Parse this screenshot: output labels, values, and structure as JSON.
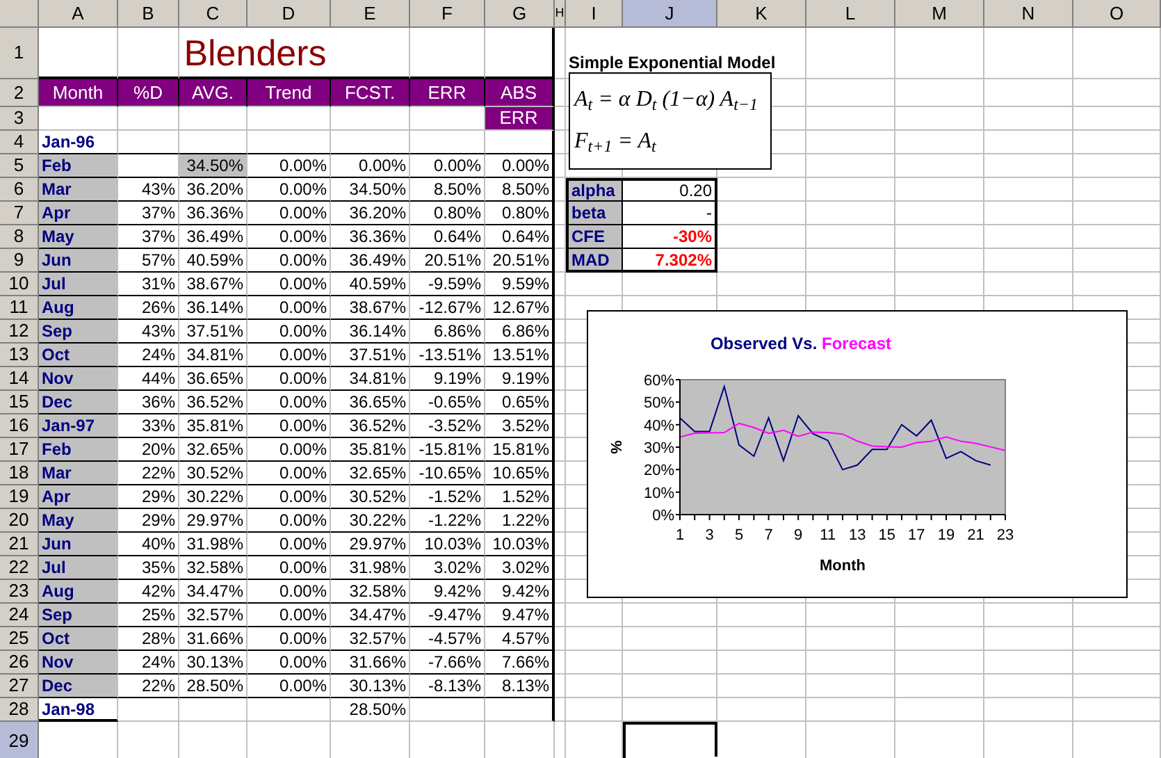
{
  "column_headers": [
    {
      "label": "A",
      "selected": false
    },
    {
      "label": "B",
      "selected": false
    },
    {
      "label": "C",
      "selected": false
    },
    {
      "label": "D",
      "selected": false
    },
    {
      "label": "E",
      "selected": false
    },
    {
      "label": "F",
      "selected": false
    },
    {
      "label": "G",
      "selected": false
    },
    {
      "label": "H",
      "selected": false
    },
    {
      "label": "I",
      "selected": false
    },
    {
      "label": "J",
      "selected": true
    },
    {
      "label": "K",
      "selected": false
    },
    {
      "label": "L",
      "selected": false
    },
    {
      "label": "M",
      "selected": false
    },
    {
      "label": "N",
      "selected": false
    },
    {
      "label": "O",
      "selected": false
    }
  ],
  "row_headers": [
    {
      "label": "1",
      "selected": false
    },
    {
      "label": "2",
      "selected": false
    },
    {
      "label": "3",
      "selected": false
    },
    {
      "label": "4",
      "selected": false
    },
    {
      "label": "5",
      "selected": false
    },
    {
      "label": "6",
      "selected": false
    },
    {
      "label": "7",
      "selected": false
    },
    {
      "label": "8",
      "selected": false
    },
    {
      "label": "9",
      "selected": false
    },
    {
      "label": "10",
      "selected": false
    },
    {
      "label": "11",
      "selected": false
    },
    {
      "label": "12",
      "selected": false
    },
    {
      "label": "13",
      "selected": false
    },
    {
      "label": "14",
      "selected": false
    },
    {
      "label": "15",
      "selected": false
    },
    {
      "label": "16",
      "selected": false
    },
    {
      "label": "17",
      "selected": false
    },
    {
      "label": "18",
      "selected": false
    },
    {
      "label": "19",
      "selected": false
    },
    {
      "label": "20",
      "selected": false
    },
    {
      "label": "21",
      "selected": false
    },
    {
      "label": "22",
      "selected": false
    },
    {
      "label": "23",
      "selected": false
    },
    {
      "label": "24",
      "selected": false
    },
    {
      "label": "25",
      "selected": false
    },
    {
      "label": "26",
      "selected": false
    },
    {
      "label": "27",
      "selected": false
    },
    {
      "label": "28",
      "selected": false
    },
    {
      "label": "29",
      "selected": true
    }
  ],
  "sheet_title": "Blenders",
  "table": {
    "columns": [
      "Month",
      "%D",
      "AVG.",
      "Trend",
      "FCST.",
      "ERR",
      "ABS"
    ],
    "last_column_line2": "ERR",
    "rows": [
      {
        "month": "Jan-96",
        "month_shaded": false,
        "avg_shaded": false
      },
      {
        "month": "Feb",
        "month_shaded": true,
        "avg_shaded": true,
        "avg": "34.50%",
        "trend": "0.00%",
        "fcst": "0.00%",
        "err": "0.00%",
        "abs_err": "0.00%"
      },
      {
        "month": "Mar",
        "month_shaded": true,
        "avg_shaded": false,
        "d": "43%",
        "avg": "36.20%",
        "trend": "0.00%",
        "fcst": "34.50%",
        "err": "8.50%",
        "abs_err": "8.50%"
      },
      {
        "month": "Apr",
        "month_shaded": true,
        "avg_shaded": false,
        "d": "37%",
        "avg": "36.36%",
        "trend": "0.00%",
        "fcst": "36.20%",
        "err": "0.80%",
        "abs_err": "0.80%"
      },
      {
        "month": "May",
        "month_shaded": true,
        "avg_shaded": false,
        "d": "37%",
        "avg": "36.49%",
        "trend": "0.00%",
        "fcst": "36.36%",
        "err": "0.64%",
        "abs_err": "0.64%"
      },
      {
        "month": "Jun",
        "month_shaded": true,
        "avg_shaded": false,
        "d": "57%",
        "avg": "40.59%",
        "trend": "0.00%",
        "fcst": "36.49%",
        "err": "20.51%",
        "abs_err": "20.51%"
      },
      {
        "month": "Jul",
        "month_shaded": true,
        "avg_shaded": false,
        "d": "31%",
        "avg": "38.67%",
        "trend": "0.00%",
        "fcst": "40.59%",
        "err": "-9.59%",
        "abs_err": "9.59%"
      },
      {
        "month": "Aug",
        "month_shaded": true,
        "avg_shaded": false,
        "d": "26%",
        "avg": "36.14%",
        "trend": "0.00%",
        "fcst": "38.67%",
        "err": "-12.67%",
        "abs_err": "12.67%"
      },
      {
        "month": "Sep",
        "month_shaded": true,
        "avg_shaded": false,
        "d": "43%",
        "avg": "37.51%",
        "trend": "0.00%",
        "fcst": "36.14%",
        "err": "6.86%",
        "abs_err": "6.86%"
      },
      {
        "month": "Oct",
        "month_shaded": true,
        "avg_shaded": false,
        "d": "24%",
        "avg": "34.81%",
        "trend": "0.00%",
        "fcst": "37.51%",
        "err": "-13.51%",
        "abs_err": "13.51%"
      },
      {
        "month": "Nov",
        "month_shaded": true,
        "avg_shaded": false,
        "d": "44%",
        "avg": "36.65%",
        "trend": "0.00%",
        "fcst": "34.81%",
        "err": "9.19%",
        "abs_err": "9.19%"
      },
      {
        "month": "Dec",
        "month_shaded": true,
        "avg_shaded": false,
        "d": "36%",
        "avg": "36.52%",
        "trend": "0.00%",
        "fcst": "36.65%",
        "err": "-0.65%",
        "abs_err": "0.65%"
      },
      {
        "month": "Jan-97",
        "month_shaded": true,
        "avg_shaded": false,
        "d": "33%",
        "avg": "35.81%",
        "trend": "0.00%",
        "fcst": "36.52%",
        "err": "-3.52%",
        "abs_err": "3.52%"
      },
      {
        "month": "Feb",
        "month_shaded": true,
        "avg_shaded": false,
        "d": "20%",
        "avg": "32.65%",
        "trend": "0.00%",
        "fcst": "35.81%",
        "err": "-15.81%",
        "abs_err": "15.81%"
      },
      {
        "month": "Mar",
        "month_shaded": true,
        "avg_shaded": false,
        "d": "22%",
        "avg": "30.52%",
        "trend": "0.00%",
        "fcst": "32.65%",
        "err": "-10.65%",
        "abs_err": "10.65%"
      },
      {
        "month": "Apr",
        "month_shaded": true,
        "avg_shaded": false,
        "d": "29%",
        "avg": "30.22%",
        "trend": "0.00%",
        "fcst": "30.52%",
        "err": "-1.52%",
        "abs_err": "1.52%"
      },
      {
        "month": "May",
        "month_shaded": true,
        "avg_shaded": false,
        "d": "29%",
        "avg": "29.97%",
        "trend": "0.00%",
        "fcst": "30.22%",
        "err": "-1.22%",
        "abs_err": "1.22%"
      },
      {
        "month": "Jun",
        "month_shaded": true,
        "avg_shaded": false,
        "d": "40%",
        "avg": "31.98%",
        "trend": "0.00%",
        "fcst": "29.97%",
        "err": "10.03%",
        "abs_err": "10.03%"
      },
      {
        "month": "Jul",
        "month_shaded": true,
        "avg_shaded": false,
        "d": "35%",
        "avg": "32.58%",
        "trend": "0.00%",
        "fcst": "31.98%",
        "err": "3.02%",
        "abs_err": "3.02%"
      },
      {
        "month": "Aug",
        "month_shaded": true,
        "avg_shaded": false,
        "d": "42%",
        "avg": "34.47%",
        "trend": "0.00%",
        "fcst": "32.58%",
        "err": "9.42%",
        "abs_err": "9.42%"
      },
      {
        "month": "Sep",
        "month_shaded": true,
        "avg_shaded": false,
        "d": "25%",
        "avg": "32.57%",
        "trend": "0.00%",
        "fcst": "34.47%",
        "err": "-9.47%",
        "abs_err": "9.47%"
      },
      {
        "month": "Oct",
        "month_shaded": true,
        "avg_shaded": false,
        "d": "28%",
        "avg": "31.66%",
        "trend": "0.00%",
        "fcst": "32.57%",
        "err": "-4.57%",
        "abs_err": "4.57%"
      },
      {
        "month": "Nov",
        "month_shaded": true,
        "avg_shaded": false,
        "d": "24%",
        "avg": "30.13%",
        "trend": "0.00%",
        "fcst": "31.66%",
        "err": "-7.66%",
        "abs_err": "7.66%"
      },
      {
        "month": "Dec",
        "month_shaded": true,
        "avg_shaded": false,
        "d": "22%",
        "avg": "28.50%",
        "trend": "0.00%",
        "fcst": "30.13%",
        "err": "-8.13%",
        "abs_err": "8.13%"
      },
      {
        "month": "Jan-98",
        "month_shaded": false,
        "avg_shaded": false,
        "fcst": "28.50%"
      }
    ]
  },
  "model": {
    "title": "Simple Exponential Model",
    "formulas": [
      "A$_{t}$ = α D$_{t}$ (1−α) A$_{t−1}$",
      "F$_{t+1}$ = A$_{t}$"
    ]
  },
  "parameters": [
    {
      "label": "alpha",
      "value": "0.20",
      "kind": "plain"
    },
    {
      "label": "beta",
      "value": "-",
      "kind": "plain"
    },
    {
      "label": "CFE",
      "value": "-30%",
      "kind": "alert"
    },
    {
      "label": "MAD",
      "value": "7.302%",
      "kind": "alert"
    }
  ],
  "chart": {
    "title_joiner": "Vs.",
    "chart_data": {
      "type": "line",
      "xlabel": "Month",
      "ylabel": "%",
      "x": [
        1,
        2,
        3,
        4,
        5,
        6,
        7,
        8,
        9,
        10,
        11,
        12,
        13,
        14,
        15,
        16,
        17,
        18,
        19,
        20,
        21,
        22,
        23
      ],
      "series": [
        {
          "name": "Observed",
          "color": "#000080",
          "values": [
            43,
            37,
            37,
            57,
            31,
            26,
            43,
            24,
            44,
            36,
            33,
            20,
            22,
            29,
            29,
            40,
            35,
            42,
            25,
            28,
            24,
            22,
            null
          ]
        },
        {
          "name": "Forecast",
          "color": "#ff00ff",
          "values": [
            34.5,
            36.2,
            36.4,
            36.5,
            40.6,
            38.7,
            36.1,
            37.5,
            34.8,
            36.7,
            36.5,
            35.8,
            32.7,
            30.5,
            30.2,
            30,
            32,
            32.6,
            34.5,
            32.6,
            31.7,
            30.1,
            28.5
          ]
        }
      ],
      "xlim": [
        1,
        23
      ],
      "ylim": [
        0,
        60
      ],
      "xticks": [
        1,
        3,
        5,
        7,
        9,
        11,
        13,
        15,
        17,
        19,
        21,
        23
      ],
      "yticks": [
        {
          "value": 0,
          "label": "0%"
        },
        {
          "value": 10,
          "label": "10%"
        },
        {
          "value": 20,
          "label": "20%"
        },
        {
          "value": 30,
          "label": "30%"
        },
        {
          "value": 40,
          "label": "40%"
        },
        {
          "value": 50,
          "label": "50%"
        },
        {
          "value": 60,
          "label": "60%"
        }
      ]
    }
  }
}
